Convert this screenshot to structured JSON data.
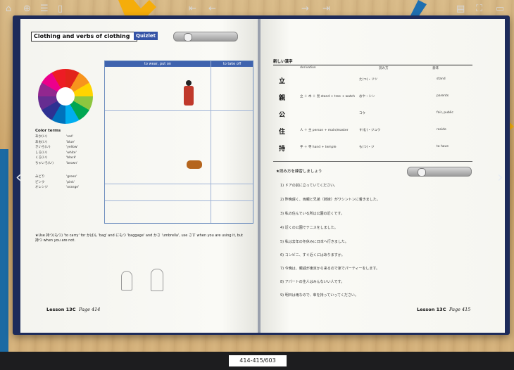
{
  "book": {
    "left_page": {
      "title": "Clothing and verbs of clothing",
      "quizlet_label": "Quizlet",
      "table_headers": [
        "to wear, put on",
        "to take off"
      ],
      "color_terms_heading": "Color terms",
      "color_terms": [
        [
          "あか(い)",
          "'red'"
        ],
        [
          "あお(い)",
          "'blue'"
        ],
        [
          "きいろ(い)",
          "'yellow'"
        ],
        [
          "しろ(い)",
          "'white'"
        ],
        [
          "くろ(い)",
          "'black'"
        ],
        [
          "ちゃいろ(い)",
          "'brown'"
        ],
        [
          "みどり",
          "'green'"
        ],
        [
          "ピンク",
          "'pink'"
        ],
        [
          "オレンジ",
          "'orange'"
        ]
      ],
      "note": "★Use 持つ(もつ) 'to carry' for かばん 'bag' and にもつ 'baggage' and かさ 'umbrella', use さす when you are using it, but 持つ when you are not.",
      "lesson_label": "Lesson 13C",
      "page_label": "Page 414"
    },
    "right_page": {
      "heading": "新しい漢字",
      "columns": [
        "derivation",
        "読み方",
        "意味"
      ],
      "kanji": [
        {
          "k": "立",
          "d": "",
          "r": "た(つ)・リツ",
          "m": "stand"
        },
        {
          "k": "親",
          "d": "立 ＋ 木 ＋ 見  stand + tree + watch",
          "r": "おや・シン",
          "m": "parents"
        },
        {
          "k": "公",
          "d": "",
          "r": "コウ",
          "m": "fair, public"
        },
        {
          "k": "住",
          "d": "人 ＋ 主  person + main/master",
          "r": "す(む)・ジュウ",
          "m": "reside"
        },
        {
          "k": "持",
          "d": "手 ＋ 寺  hand + temple",
          "r": "も(つ)・ジ",
          "m": "to have"
        }
      ],
      "exercise_title": "★読み方を練習しましょう",
      "sentences": [
        "1) ドアの前に立っていてください。",
        "2) 昨晩遅く、両親と兄弟（姉妹）がワシントンに着きました。",
        "3) 私の住んでいる所は公園の近くです。",
        "4) 近くの公園でテニスをしました。",
        "5) 私は去年の冬休みに日本へ行きました。",
        "6) コンビニ、すぐ近くにはありますか。",
        "7) 今晩は、親戚が東京から来るので家でパーティーをします。",
        "8) アパートの住人はみんないい人です。",
        "9) 明日は雨なので、傘を持っていってください。"
      ],
      "lesson_label": "Lesson 13C",
      "page_label": "Page 415"
    }
  },
  "toolbar": {
    "page_indicator": "414-415/603"
  }
}
